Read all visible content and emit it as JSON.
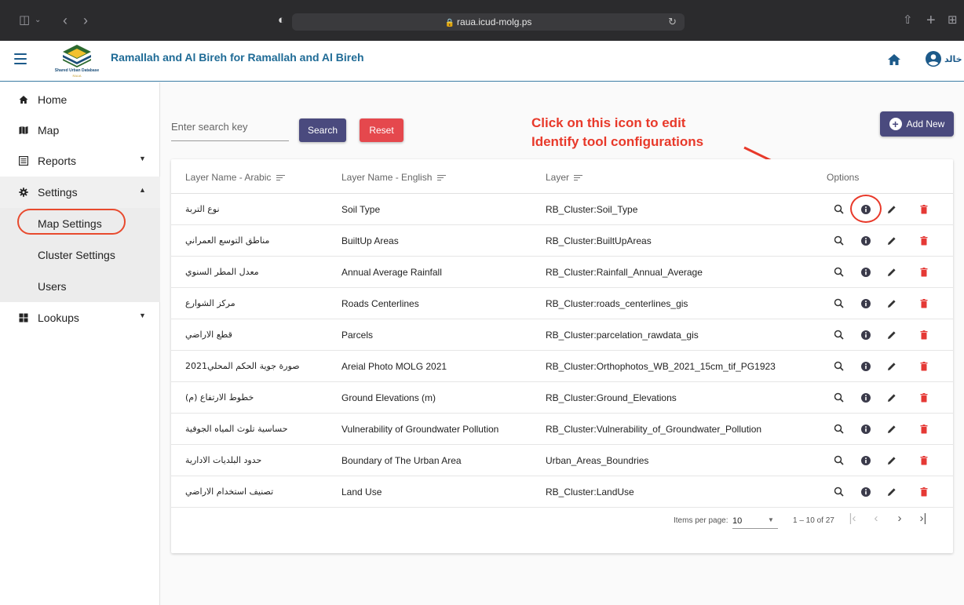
{
  "browser": {
    "url": "raua.icud-molg.ps"
  },
  "header": {
    "title": "Ramallah and Al Bireh for Ramallah and Al Bireh",
    "logo_text": "Shared Urban Database",
    "logo_sub": "RAUA",
    "user_name": "خالد"
  },
  "sidebar": {
    "items": [
      {
        "label": "Home",
        "icon": "home-icon"
      },
      {
        "label": "Map",
        "icon": "map-icon"
      },
      {
        "label": "Reports",
        "icon": "reports-icon"
      },
      {
        "label": "Settings",
        "icon": "gear-icon"
      },
      {
        "label": "Lookups",
        "icon": "lookups-icon"
      }
    ],
    "settings_sub": [
      {
        "label": "Map Settings"
      },
      {
        "label": "Cluster Settings"
      },
      {
        "label": "Users"
      }
    ]
  },
  "toolbar": {
    "search_placeholder": "Enter search key",
    "search_label": "Search",
    "reset_label": "Reset",
    "add_label": "Add New"
  },
  "annotation": {
    "line1": "Click on this icon to edit",
    "line2": "Identify tool configurations",
    "color": "#e8392a"
  },
  "table": {
    "headers": {
      "arabic": "Layer Name - Arabic",
      "english": "Layer Name - English",
      "layer": "Layer",
      "options": "Options"
    },
    "rows": [
      {
        "arabic": "نوع التربة",
        "english": "Soil Type",
        "layer": "RB_Cluster:Soil_Type"
      },
      {
        "arabic": "مناطق التوسع العمراني",
        "english": "BuiltUp Areas",
        "layer": "RB_Cluster:BuiltUpAreas"
      },
      {
        "arabic": "معدل المطر السنوي",
        "english": "Annual Average Rainfall",
        "layer": "RB_Cluster:Rainfall_Annual_Average"
      },
      {
        "arabic": "مركز الشوارع",
        "english": "Roads Centerlines",
        "layer": "RB_Cluster:roads_centerlines_gis"
      },
      {
        "arabic": "قطع الاراضي",
        "english": "Parcels",
        "layer": "RB_Cluster:parcelation_rawdata_gis"
      },
      {
        "arabic": "صورة جوية الحكم المحلي2021",
        "english": "Areial Photo MOLG 2021",
        "layer": "RB_Cluster:Orthophotos_WB_2021_15cm_tif_PG1923"
      },
      {
        "arabic": "(خطوط الارتفاع (م",
        "english": "Ground Elevations (m)",
        "layer": "RB_Cluster:Ground_Elevations"
      },
      {
        "arabic": "حساسية تلوث المياه الجوفية",
        "english": "Vulnerability of Groundwater Pollution",
        "layer": "RB_Cluster:Vulnerability_of_Groundwater_Pollution"
      },
      {
        "arabic": "حدود البلديات الادارية",
        "english": "Boundary of The Urban Area",
        "layer": "Urban_Areas_Boundries"
      },
      {
        "arabic": "تصنيف استخدام الاراضي",
        "english": "Land Use",
        "layer": "RB_Cluster:LandUse"
      }
    ]
  },
  "paginator": {
    "label": "Items per page:",
    "page_size": "10",
    "range": "1 – 10 of 27"
  },
  "colors": {
    "primary": "#4a4a7e",
    "danger": "#e5484d",
    "title": "#1f6b96",
    "annotation": "#e8392a"
  }
}
